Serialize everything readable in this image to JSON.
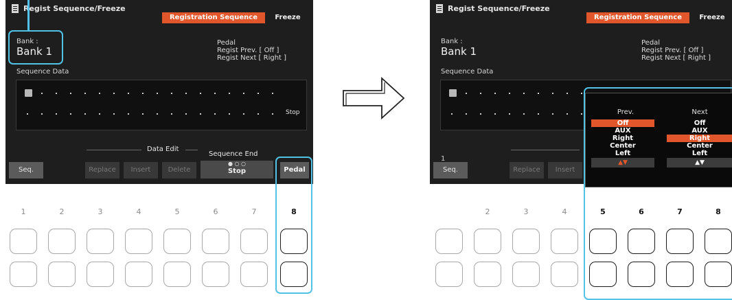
{
  "screen": {
    "title": "Regist Sequence/Freeze",
    "tabs": [
      "Registration Sequence",
      "Freeze"
    ],
    "bank_label": "Bank :",
    "bank_value": "Bank 1",
    "pedal_title": "Pedal",
    "regist_prev": "Regist Prev. [  Off  ]",
    "regist_next": "Regist Next [  Right  ]",
    "sequence_data_label": "Sequence Data",
    "stop_label": "Stop",
    "data_edit_label": "Data Edit",
    "sequence_end_label": "Sequence End",
    "sequence_end_dots": "● ○ ○",
    "sequence_end_value": "Stop",
    "buttons": {
      "seq": "Seq.",
      "replace": "Replace",
      "insert": "Insert",
      "delete": "Delete",
      "pedal": "Pedal"
    },
    "right_number_label": "1"
  },
  "popup": {
    "prev_header": "Prev.",
    "next_header": "Next",
    "prev_options": [
      "Off",
      "AUX",
      "Right",
      "Center",
      "Left"
    ],
    "next_options": [
      "Off",
      "AUX",
      "Right",
      "Center",
      "Left"
    ],
    "prev_selected": "Off",
    "next_selected": "Right",
    "prev_arrows": "▲▼",
    "next_arrows": "▲▼"
  },
  "left_button_numbers": [
    "1",
    "2",
    "3",
    "4",
    "5",
    "6",
    "7",
    "8"
  ],
  "right_button_numbers": [
    "2",
    "3",
    "4",
    "5",
    "6",
    "7",
    "8"
  ],
  "colors": {
    "accent": "#e1562a",
    "highlight": "#52c2e8",
    "screen_bg": "#1e1e1e"
  }
}
